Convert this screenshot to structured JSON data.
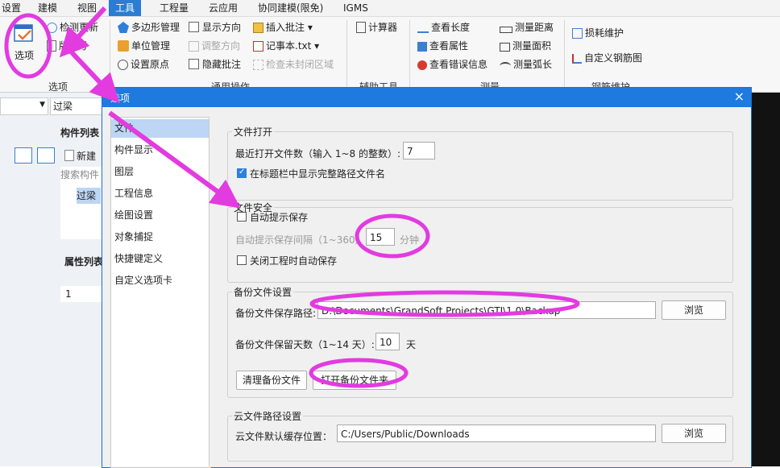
{
  "menubar": {
    "items": [
      "设置",
      "建模",
      "视图",
      "工具",
      "工程量",
      "云应用",
      "协同建模(限免)",
      "IGMS"
    ],
    "active": "工具"
  },
  "ribbon": {
    "options_label": "选项",
    "check_update": "检测更新",
    "version": "版本号",
    "polygon_mgmt": "多边形管理",
    "unit_mgmt": "单位管理",
    "set_origin": "设置原点",
    "show_direction": "显示方向",
    "adjust_direction": "调整方向",
    "hide_comments": "隐藏批注",
    "insert_comment": "插入批注",
    "notepad": "记事本.txt",
    "check_unclosed": "检查未封闭区域",
    "calculator": "计算器",
    "view_length": "查看长度",
    "view_props": "查看属性",
    "view_errors": "查看错误信息",
    "measure_distance": "测量距离",
    "measure_area": "测量面积",
    "measure_arc": "测量弧长",
    "loss_maintenance": "损耗维护",
    "custom_rebar": "自定义钢筋图",
    "groups": [
      "选项",
      "通用操作",
      "辅助工具",
      "测量",
      "钢筋维护"
    ]
  },
  "left": {
    "dropdown_value": "过梁",
    "component_list_title": "构件列表",
    "new_label": "新建",
    "search_placeholder": "搜索构件",
    "item": "过梁",
    "attr_list_title": "属性列表",
    "row_num": "1"
  },
  "dialog": {
    "title": "选项",
    "close": "×",
    "nav": [
      "文件",
      "构件显示",
      "图层",
      "工程信息",
      "绘图设置",
      "对象捕捉",
      "快捷键定义",
      "自定义选项卡"
    ],
    "selected_nav": "文件",
    "file_open": {
      "legend": "文件打开",
      "recent_label": "最近打开文件数（输入 1~8 的整数）:",
      "recent_value": "7",
      "show_full_path": "在标题栏中显示完整路径文件名",
      "show_full_path_checked": true
    },
    "file_safety": {
      "legend": "文件安全",
      "auto_save": "自动提示保存",
      "auto_save_checked": false,
      "interval_label": "自动提示保存间隔（1~360）:",
      "interval_value": "15",
      "interval_unit": "分钟",
      "close_auto_save": "关闭工程时自动保存",
      "close_auto_save_checked": false
    },
    "backup": {
      "legend": "备份文件设置",
      "path_label": "备份文件保存路径:",
      "path_value": "D:\\Documents\\GrandSoft Projects\\GTJ\\1.0\\Backup",
      "browse": "浏览",
      "days_label": "备份文件保留天数（1~14 天）:",
      "days_value": "10",
      "days_unit": "天",
      "clean": "清理备份文件",
      "open_folder": "打开备份文件夹"
    },
    "cloud": {
      "legend": "云文件路径设置",
      "cache_label": "云文件默认缓存位置：",
      "cache_value": "C:/Users/Public/Downloads",
      "browse": "浏览"
    }
  },
  "annotation_color": "#e23be0"
}
